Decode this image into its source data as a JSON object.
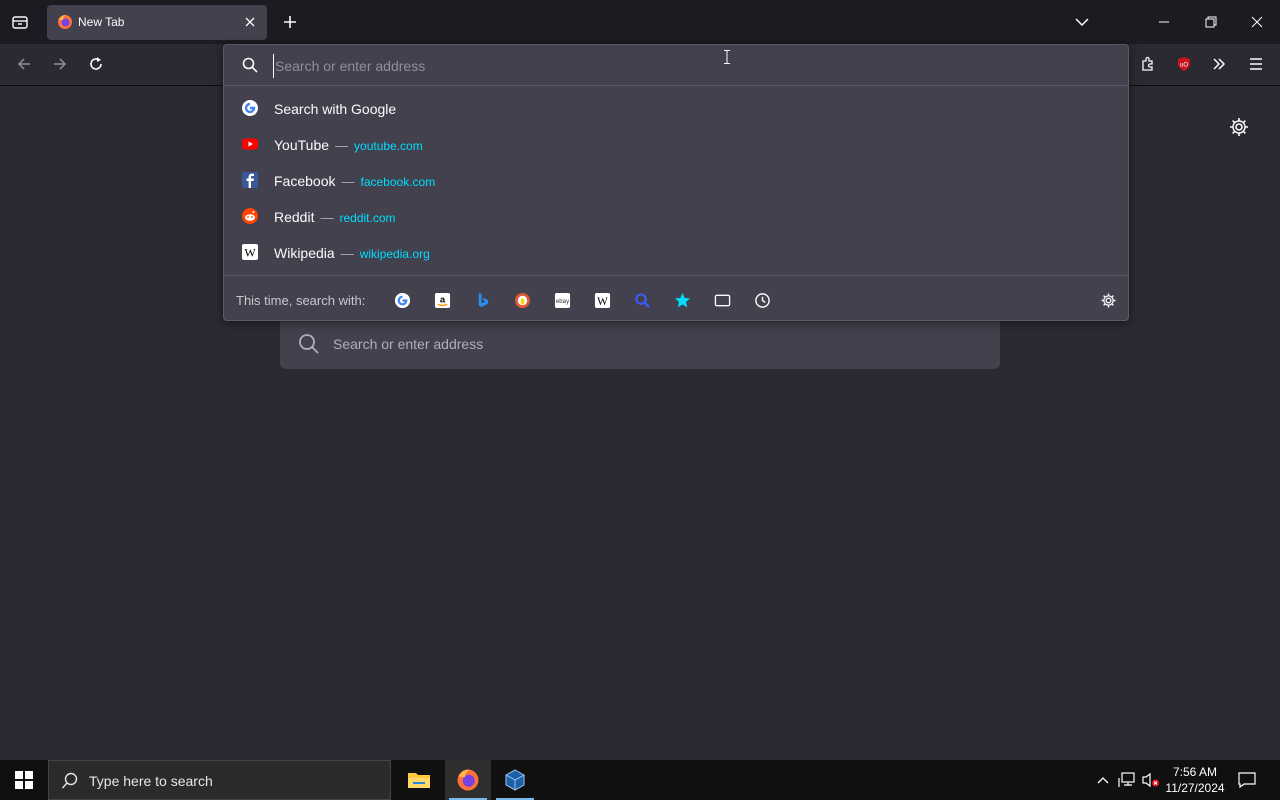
{
  "tab": {
    "title": "New Tab"
  },
  "urlbar": {
    "placeholder": "Search or enter address",
    "value": "",
    "results": [
      {
        "title": "Search with Google",
        "url": "",
        "icon": "google-icon"
      },
      {
        "title": "YouTube",
        "url": "youtube.com",
        "icon": "youtube-icon"
      },
      {
        "title": "Facebook",
        "url": "facebook.com",
        "icon": "facebook-icon"
      },
      {
        "title": "Reddit",
        "url": "reddit.com",
        "icon": "reddit-icon"
      },
      {
        "title": "Wikipedia",
        "url": "wikipedia.org",
        "icon": "wikipedia-icon"
      }
    ],
    "separator": "—",
    "oneoff_label": "This time, search with:",
    "oneoff_engines": [
      "google-icon",
      "amazon-icon",
      "bing-icon",
      "duckduckgo-icon",
      "ebay-icon",
      "wikipedia-icon",
      "search-icon",
      "bookmarks-star-icon",
      "tabs-icon",
      "history-clock-icon"
    ]
  },
  "ntp": {
    "search_placeholder": "Search or enter address"
  },
  "taskbar": {
    "search_placeholder": "Type here to search",
    "time": "7:56 AM",
    "date": "11/27/2024"
  },
  "colors": {
    "accent_url": "#00ddff",
    "panel_bg": "#42414d",
    "page_bg": "#2b2a33",
    "taskbar_bg": "#101010"
  }
}
